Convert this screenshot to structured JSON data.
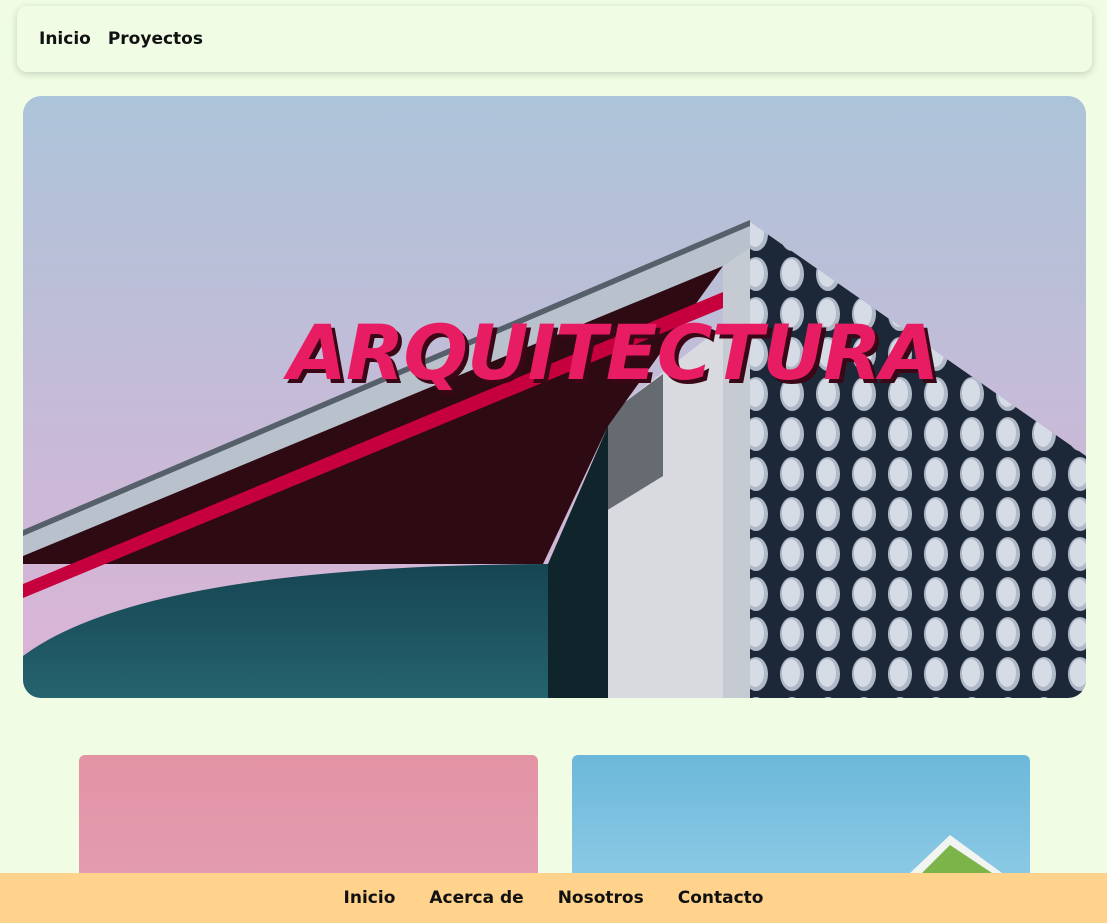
{
  "header": {
    "nav": [
      {
        "label": "Inicio"
      },
      {
        "label": "Proyectos"
      }
    ]
  },
  "hero": {
    "title": "ARQUITECTURA",
    "colors": {
      "title": "#e81c62",
      "title_shadow": "#3a0716",
      "sky_top": "#acc4d9",
      "sky_bottom": "#ddb3d6"
    }
  },
  "cards": [
    {
      "color": "#e393a4"
    },
    {
      "color": "#6cb8da"
    }
  ],
  "footer": {
    "nav": [
      {
        "label": "Inicio"
      },
      {
        "label": "Acerca de"
      },
      {
        "label": "Nosotros"
      },
      {
        "label": "Contacto"
      }
    ],
    "background": "#ffd38c"
  },
  "page": {
    "background": "#f0fde4"
  }
}
